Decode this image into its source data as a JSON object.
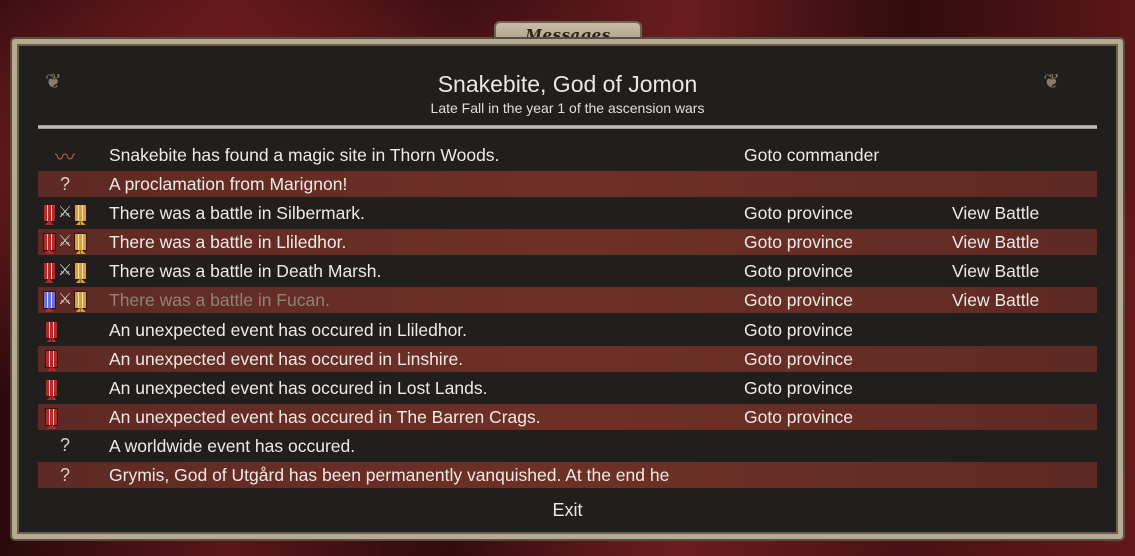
{
  "tab_label": "Messages",
  "header": {
    "title": "Snakebite, God of Jomon",
    "subtitle": "Late Fall in the year 1 of the ascension wars"
  },
  "messages": [
    {
      "icon": "snake-icon",
      "text": "Snakebite has found a magic site in Thorn Woods.",
      "goto": "Goto commander",
      "view": ""
    },
    {
      "icon": "question-icon",
      "text": "A proclamation from Marignon!",
      "goto": "",
      "view": ""
    },
    {
      "icon": "battle-icon",
      "text": "There was a battle in Silbermark.",
      "goto": "Goto province",
      "view": "View Battle"
    },
    {
      "icon": "battle-icon",
      "text": "There was a battle in Lliledhor.",
      "goto": "Goto province",
      "view": "View Battle"
    },
    {
      "icon": "battle-icon",
      "text": "There was a battle in Death Marsh.",
      "goto": "Goto province",
      "view": "View Battle"
    },
    {
      "icon": "battle-icon",
      "text": "There was a battle in Fucan.",
      "goto": "Goto province",
      "view": "View Battle"
    },
    {
      "icon": "banner-icon",
      "text": "An unexpected event has occured in Lliledhor.",
      "goto": "Goto province",
      "view": ""
    },
    {
      "icon": "banner-icon",
      "text": "An unexpected event has occured in Linshire.",
      "goto": "Goto province",
      "view": ""
    },
    {
      "icon": "banner-icon",
      "text": "An unexpected event has occured in Lost Lands.",
      "goto": "Goto province",
      "view": ""
    },
    {
      "icon": "banner-icon",
      "text": "An unexpected event has occured in The Barren Crags.",
      "goto": "Goto province",
      "view": ""
    },
    {
      "icon": "question-icon",
      "text": "A worldwide event has occured.",
      "goto": "",
      "view": ""
    },
    {
      "icon": "question-icon",
      "text": "Grymis, God of Utgård has been permanently vanquished. At the end he",
      "goto": "",
      "view": ""
    }
  ],
  "icons": {
    "question": "?"
  },
  "exit_label": "Exit",
  "colors": {
    "stripe": "#6e3026",
    "panel": "#201f1e",
    "frame": "#b7aa93"
  }
}
